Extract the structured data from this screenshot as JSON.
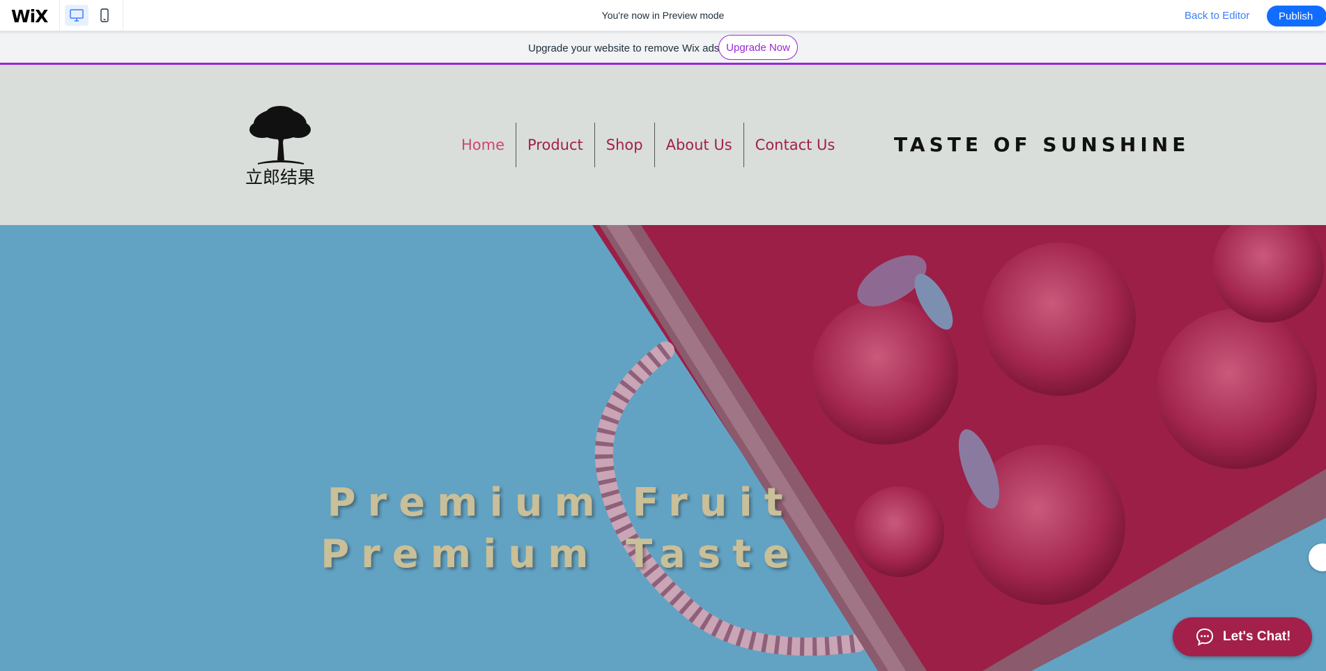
{
  "wix_bar": {
    "logo": "WiX",
    "preview_text": "You're now in Preview mode",
    "back_label": "Back to Editor",
    "publish_label": "Publish"
  },
  "upgrade": {
    "message": "Upgrade your website to remove Wix ads",
    "button_label": "Upgrade Now"
  },
  "header": {
    "logo_text": "立郎结果",
    "nav": [
      {
        "label": "Home",
        "active": true
      },
      {
        "label": "Product"
      },
      {
        "label": "Shop"
      },
      {
        "label": "About Us"
      },
      {
        "label": "Contact Us"
      }
    ],
    "tagline": "TASTE OF SUNSHINE"
  },
  "hero": {
    "line1": "Premium Fruit",
    "line2": "Premium Taste"
  },
  "chat": {
    "label": "Let's Chat!"
  },
  "colors": {
    "accent": "#a3204a",
    "hero_bg": "#62a3c4",
    "header_bg": "#d9dedb",
    "publish": "#116dff",
    "upgrade_accent": "#9a27d5"
  }
}
